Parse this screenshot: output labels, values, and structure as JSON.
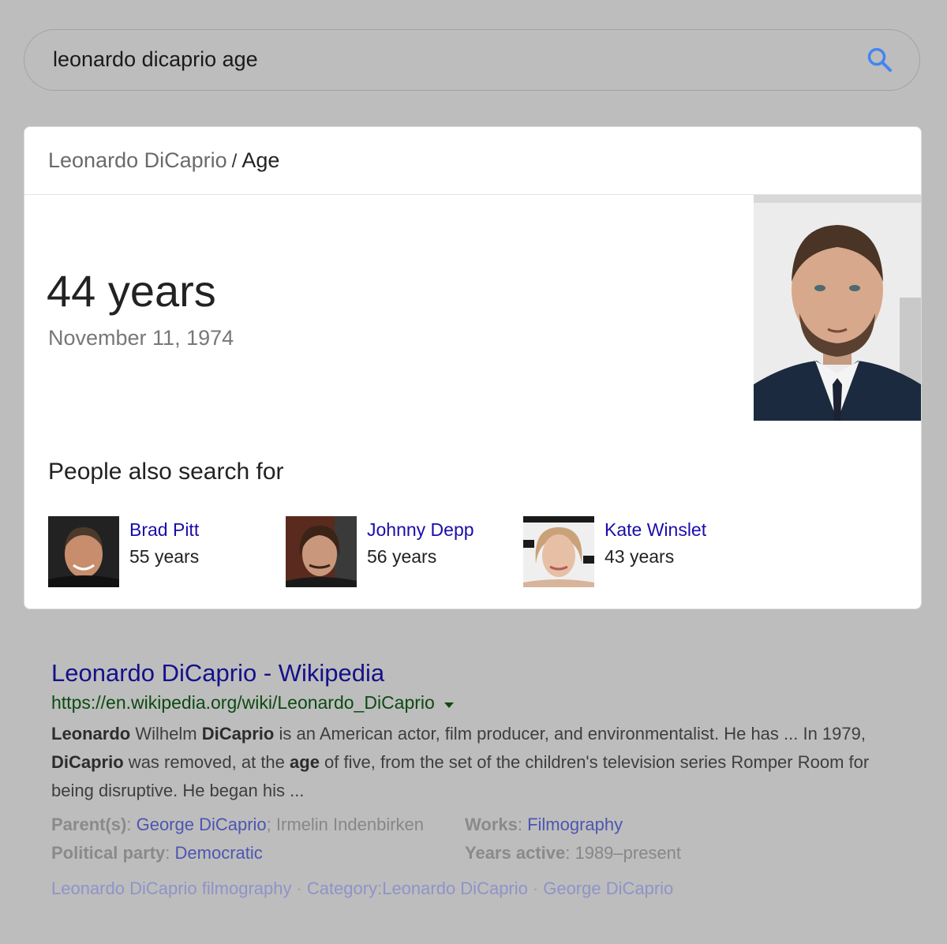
{
  "search": {
    "query": "leonardo dicaprio age"
  },
  "card": {
    "breadcrumb_entity": "Leonardo DiCaprio",
    "breadcrumb_sep": "/",
    "breadcrumb_attr": "Age",
    "age": "44 years",
    "birth_date": "November 11, 1974",
    "pasf_title": "People also search for",
    "people": [
      {
        "name": "Brad Pitt",
        "age": "55 years"
      },
      {
        "name": "Johnny Depp",
        "age": "56 years"
      },
      {
        "name": "Kate Winslet",
        "age": "43 years"
      }
    ]
  },
  "result": {
    "title": "Leonardo DiCaprio - Wikipedia",
    "url": "https://en.wikipedia.org/wiki/Leonardo_DiCaprio",
    "snippet": {
      "s1_b": "Leonardo",
      "s2": " Wilhelm ",
      "s3_b": "DiCaprio",
      "s4": " is an American actor, film producer, and environmentalist. He has ... In 1979, ",
      "s5_b": "DiCaprio",
      "s6": " was removed, at the ",
      "s7_b": "age",
      "s8": " of five, from the set of the children's television series Romper Room for being disruptive. He began his ..."
    },
    "facts": {
      "parents_label": "Parent(s)",
      "parents_link": "George DiCaprio",
      "parents_other": "Irmelin Indenbirken",
      "works_label": "Works",
      "works_link": "Filmography",
      "party_label": "Political party",
      "party_link": "Democratic",
      "years_label": "Years active",
      "years_value": "1989–present"
    },
    "related_links": [
      "Leonardo DiCaprio filmography",
      "Category:Leonardo DiCaprio",
      "George DiCaprio"
    ],
    "related_sep": "·"
  },
  "colors": {
    "link": "#1a0dab",
    "url_green": "#0c4a11",
    "search_icon": "#4285f4"
  }
}
